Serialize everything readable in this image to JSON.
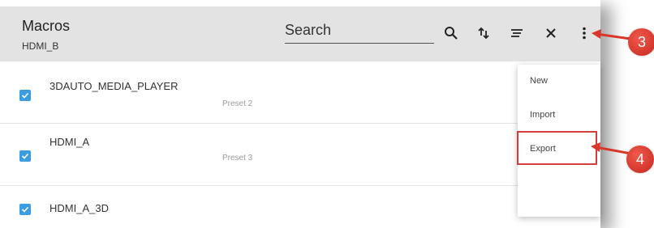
{
  "header": {
    "title": "Macros",
    "subtitle": "HDMI_B",
    "search_placeholder": "Search",
    "icons": [
      "search-icon",
      "sort-icon",
      "filter-icon",
      "close-icon",
      "more-vert-icon"
    ]
  },
  "rows": [
    {
      "name": "3DAUTO_MEDIA_PLAYER",
      "sub": "Preset 2",
      "checked": true
    },
    {
      "name": "HDMI_A",
      "sub": "Preset 3",
      "checked": true
    },
    {
      "name": "HDMI_A_3D",
      "sub": "",
      "checked": true
    }
  ],
  "menu": {
    "items": [
      "New",
      "Import",
      "Export"
    ],
    "highlighted": "Export"
  },
  "callouts": [
    "3",
    "4"
  ],
  "colors": {
    "header_bg": "#e3e3e3",
    "checkbox": "#3d9be0",
    "highlight": "#d63c3c",
    "callout": "#d9362a"
  }
}
